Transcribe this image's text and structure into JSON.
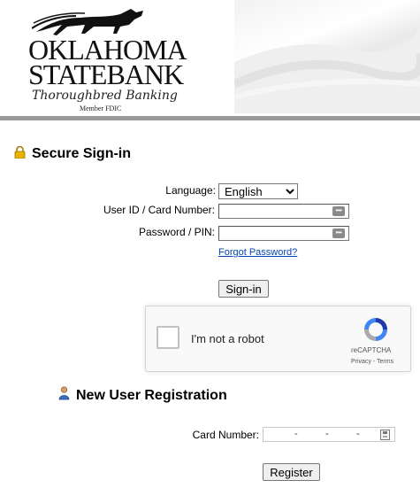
{
  "bank": {
    "name_line1": "OKLAHOMA",
    "name_line2": "STATEBANK",
    "tagline": "Thoroughbred Banking",
    "fdic": "Member FDIC"
  },
  "signin": {
    "title": "Secure Sign-in",
    "language_label": "Language:",
    "language_value": "English",
    "userid_label": "User ID / Card Number:",
    "password_label": "Password / PIN:",
    "forgot_link": "Forgot Password?",
    "submit_label": "Sign-in"
  },
  "captcha": {
    "label": "I'm not a robot",
    "brand": "reCAPTCHA",
    "links": "Privacy - Terms"
  },
  "registration": {
    "title": "New User Registration",
    "card_label": "Card Number:",
    "card_separator": "-",
    "register_label": "Register"
  },
  "icons": {
    "lock": "lock-icon",
    "user": "user-icon",
    "password_manager": "password-manager-icon"
  }
}
